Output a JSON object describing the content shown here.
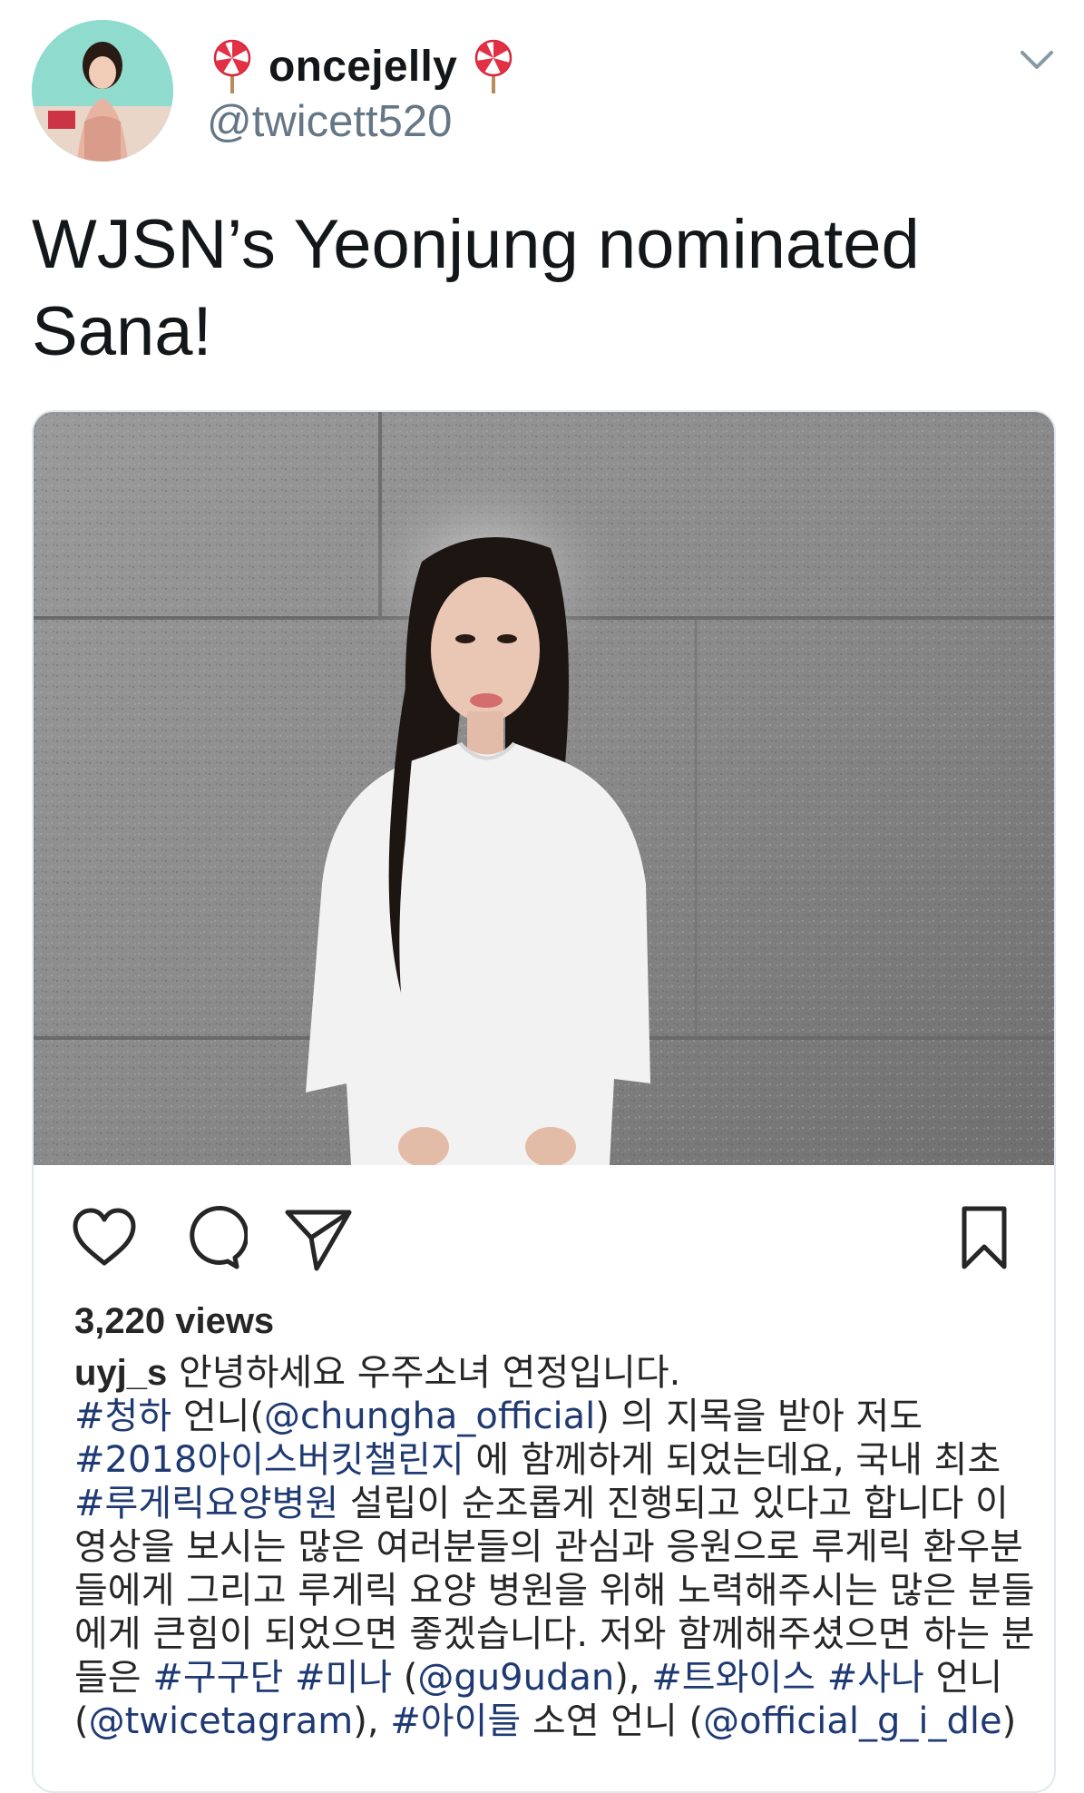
{
  "tweet": {
    "display_name": "oncejelly",
    "name_decoration_icon": "lollipop-icon",
    "handle": "@twicett520",
    "text": "WJSN’s Yeonjung nominated Sana!",
    "menu_icon": "chevron-down-icon"
  },
  "instagram_post": {
    "icons": {
      "like": "heart-icon",
      "comment": "comment-bubble-icon",
      "share": "paper-plane-icon",
      "save": "bookmark-icon"
    },
    "views": "3,220 views",
    "caption": {
      "username": "uyj_s",
      "segments": [
        {
          "t": " 안녕하세요 우주소녀 연정입니다.",
          "tag": false
        },
        {
          "t": "\n",
          "tag": false
        },
        {
          "t": "#청하",
          "tag": true
        },
        {
          "t": " 언니(",
          "tag": false
        },
        {
          "t": "@chungha_official",
          "tag": true
        },
        {
          "t": ") 의 지목을 받아 저도 ",
          "tag": false
        },
        {
          "t": "#2018아이스버킷챌린지",
          "tag": true
        },
        {
          "t": " 에 함께하게 되었는데요, 국내 최초 ",
          "tag": false
        },
        {
          "t": "#루게릭요양병원",
          "tag": true
        },
        {
          "t": " 설립이 순조롭게 진행되고 있다고 합니다 이 영상을 보시는 많은 여러분들의 관심과 응원으로 루게릭 환우분들에게 그리고 루게릭 요양 병원을 위해 노력해주시는 많은 분들에게 큰힘이 되었으면 좋겠습니다. 저와 함께해주셨으면 하는 분들은 ",
          "tag": false
        },
        {
          "t": "#구구단",
          "tag": true
        },
        {
          "t": " ",
          "tag": false
        },
        {
          "t": "#미나",
          "tag": true
        },
        {
          "t": " (",
          "tag": false
        },
        {
          "t": "@gu9udan",
          "tag": true
        },
        {
          "t": "), ",
          "tag": false
        },
        {
          "t": "#트와이스",
          "tag": true
        },
        {
          "t": " ",
          "tag": false
        },
        {
          "t": "#사나",
          "tag": true
        },
        {
          "t": " 언니 (",
          "tag": false
        },
        {
          "t": "@twicetagram",
          "tag": true
        },
        {
          "t": "), ",
          "tag": false
        },
        {
          "t": "#아이들",
          "tag": true
        },
        {
          "t": " 소연 언니 (",
          "tag": false
        },
        {
          "t": "@official_g_i_dle",
          "tag": true
        },
        {
          "t": ")",
          "tag": false
        }
      ]
    }
  },
  "colors": {
    "handle_gray": "#657786",
    "hashtag_blue": "#1f3a73",
    "text_dark": "#14171a",
    "card_border": "#e1e8ed"
  }
}
